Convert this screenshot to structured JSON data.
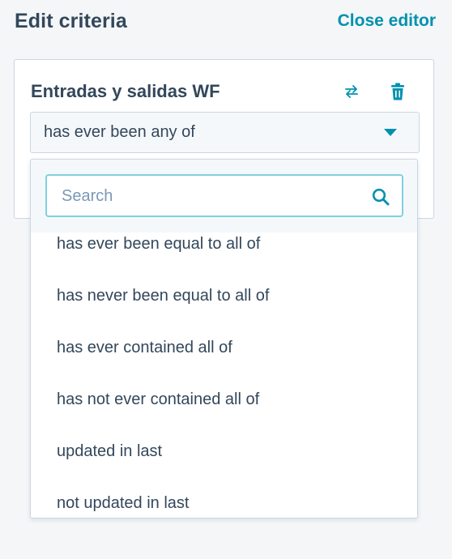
{
  "header": {
    "title": "Edit criteria",
    "close_label": "Close editor"
  },
  "card": {
    "title": "Entradas y salidas WF",
    "select": {
      "value": "has ever been any of"
    }
  },
  "dropdown": {
    "search": {
      "placeholder": "Search",
      "value": ""
    },
    "options": [
      {
        "label": "has ever been equal to all of"
      },
      {
        "label": "has never been equal to all of"
      },
      {
        "label": "has ever contained all of"
      },
      {
        "label": "has not ever contained all of"
      },
      {
        "label": "updated in last"
      },
      {
        "label": "not updated in last"
      }
    ]
  },
  "colors": {
    "text": "#33475b",
    "accent": "#0091ae",
    "focus_border": "#7fd1de",
    "background": "#f4f6f8"
  },
  "icons": {
    "swap": "swap-arrows-icon",
    "delete": "trash-icon",
    "search": "search-icon",
    "caret": "caret-down-icon"
  }
}
